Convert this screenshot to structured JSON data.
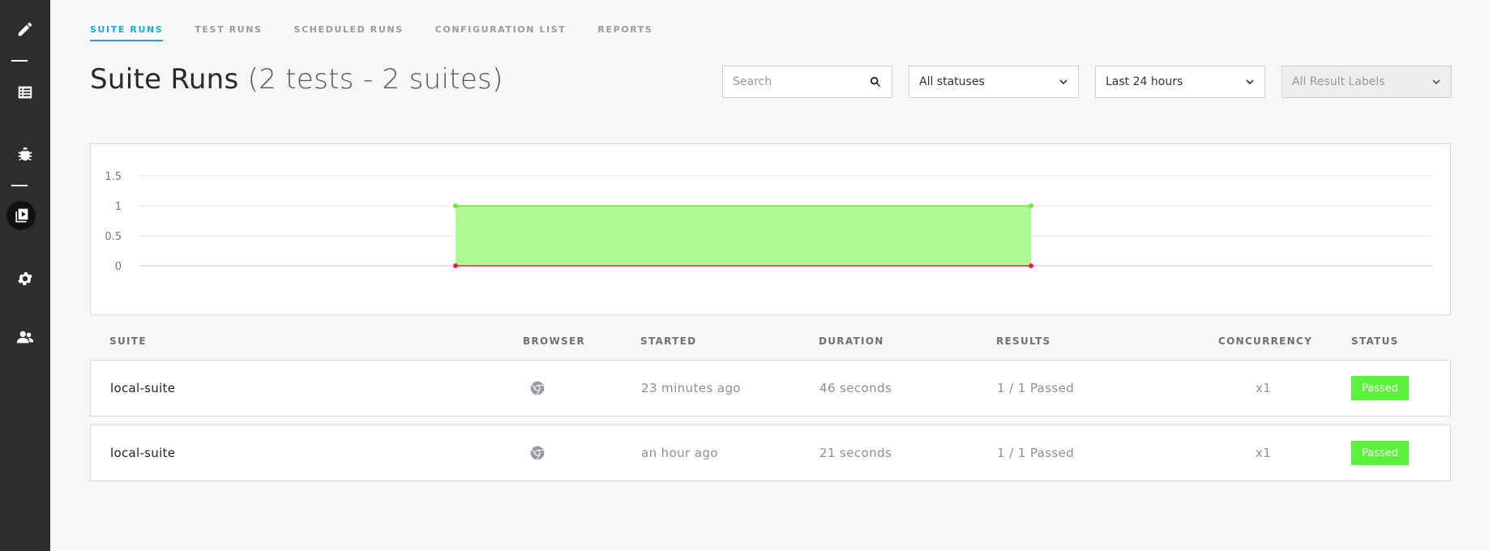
{
  "sidebar": {
    "items": [
      {
        "icon": "pencil-icon"
      },
      {
        "icon": "list-icon"
      },
      {
        "icon": "bug-icon"
      },
      {
        "icon": "suite-runs-icon",
        "active": true
      },
      {
        "icon": "gear-icon"
      },
      {
        "icon": "users-icon"
      }
    ]
  },
  "nav": {
    "tabs": [
      {
        "label": "SUITE RUNS",
        "active": true
      },
      {
        "label": "TEST RUNS"
      },
      {
        "label": "SCHEDULED RUNS"
      },
      {
        "label": "CONFIGURATION LIST"
      },
      {
        "label": "REPORTS"
      }
    ]
  },
  "header": {
    "title": "Suite Runs",
    "subtitle": "(2 tests - 2 suites)"
  },
  "filters": {
    "search_placeholder": "Search",
    "status": "All statuses",
    "time_range": "Last 24 hours",
    "result_labels": "All Result Labels"
  },
  "chart_data": {
    "type": "area",
    "x": [
      0,
      1
    ],
    "series": [
      {
        "color": "#6ee83d",
        "fill": "#aefb93",
        "values": [
          1,
          1
        ]
      },
      {
        "color": "#e0244a",
        "values": [
          0,
          0
        ]
      }
    ],
    "yticks": [
      "1.5",
      "1",
      "0.5",
      "0"
    ],
    "ylim": [
      0,
      1.5
    ],
    "grid": true
  },
  "table": {
    "columns": [
      "SUITE",
      "BROWSER",
      "STARTED",
      "DURATION",
      "RESULTS",
      "CONCURRENCY",
      "STATUS"
    ],
    "rows": [
      {
        "suite": "local-suite",
        "browser": "chrome-icon",
        "started": "23 minutes ago",
        "duration": "46 seconds",
        "results": "1 / 1 Passed",
        "concurrency": "x1",
        "status": "Passed"
      },
      {
        "suite": "local-suite",
        "browser": "chrome-icon",
        "started": "an hour ago",
        "duration": "21 seconds",
        "results": "1 / 1 Passed",
        "concurrency": "x1",
        "status": "Passed"
      }
    ]
  },
  "colors": {
    "accent": "#1ba9d6",
    "sidebar": "#2d2d2d",
    "passed": "#5cf13c"
  }
}
